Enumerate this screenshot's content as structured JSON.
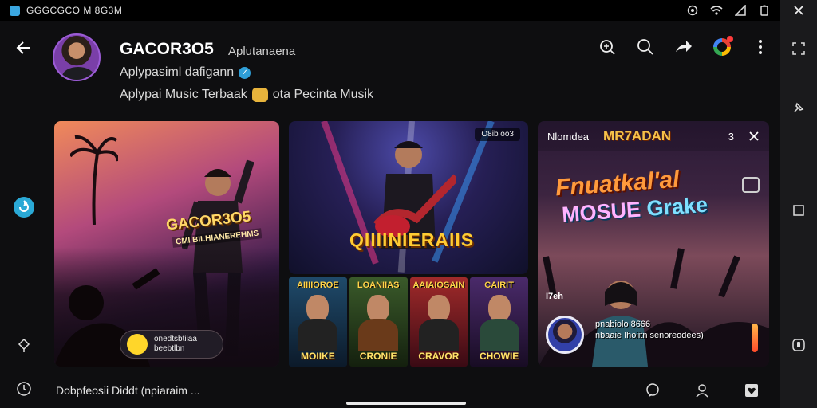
{
  "status_bar": {
    "text": "GGGCGCO M 8G3M"
  },
  "header": {
    "channel_name": "GACOR3O5",
    "channel_tag": "Aplutanaena",
    "line1": "Aplypasiml dafigann",
    "line2_a": "Aplypai Music Terbaak",
    "line2_b": "ota Pecinta Musik"
  },
  "cards": {
    "card1": {
      "overlay_title": "GACOR3O5",
      "overlay_sub": "CMI BILHIANEREHMS",
      "pill_line1": "onedtsbtiiaa",
      "pill_line2": "beebtlbn"
    },
    "card2": {
      "badge": "O8ib oo3",
      "title": "QIIIINIERAIIS"
    },
    "thumbs": [
      {
        "top": "AIIIIOROE",
        "bottom": "MOIIKE",
        "bg": "#1f4a6a"
      },
      {
        "top": "LOANIIAS",
        "bottom": "CRONIE",
        "bg": "#3a5a2a"
      },
      {
        "top": "AAIAIOSAIN",
        "bottom": "CRAVOR",
        "bg": "#6a1f2a"
      },
      {
        "top": "CAIRIT",
        "bottom": "CHOWIE",
        "bg": "#3a2a5a"
      }
    ],
    "card3": {
      "label": "Nlomdea",
      "brand": "MR7ADAN",
      "number": "3",
      "big1": "Fnuatkal'al",
      "big2_a": "MOSUE",
      "big2_b": "Grake",
      "small_left": "I7eh",
      "caption_line1": "pnabiolo 8666",
      "caption_line2": "nbaaie Ihoiitn senoreodees)"
    }
  },
  "bottom_bar": {
    "text": "Dobpfeosii Diddt   (npiaraim ..."
  },
  "colors": {
    "accent_teal": "#2aa9d6",
    "accent_yellow": "#ffd62a",
    "notification": "#ff3b3b"
  },
  "icons": {
    "back": "arrow-left-icon",
    "zoom": "zoom-icon",
    "search": "search-icon",
    "share": "share-arrow-icon",
    "more": "more-vertical-icon",
    "close": "close-icon"
  }
}
